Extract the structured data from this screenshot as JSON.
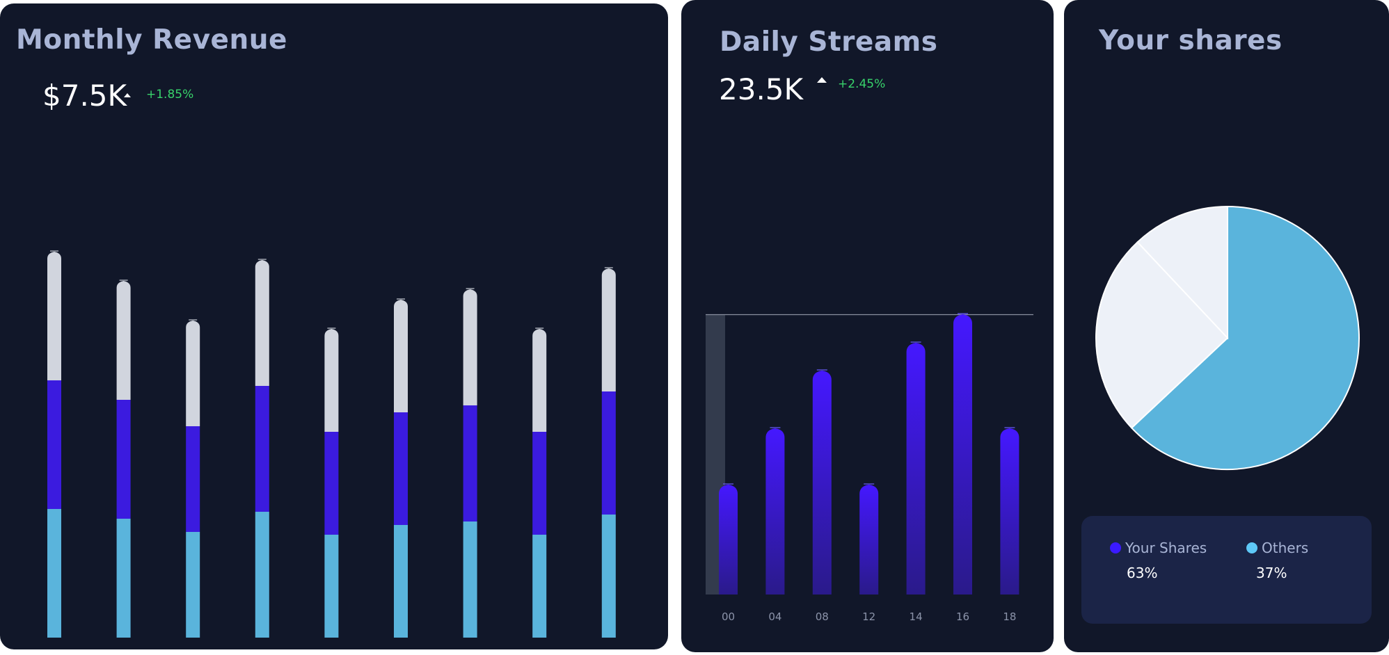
{
  "revenue": {
    "title": "Monthly Revenue",
    "value": "$7.5K",
    "delta": "+1.85%"
  },
  "streams": {
    "title": "Daily Streams",
    "value": "23.5K",
    "delta": "+2.45%"
  },
  "shares": {
    "title": "Your shares",
    "legend": [
      {
        "label": "Your Shares",
        "percent": "63%",
        "color": "#3b1aff"
      },
      {
        "label": "Others",
        "percent": "37%",
        "color": "#5ec8f7"
      }
    ]
  },
  "colors": {
    "card_bg": "#111729",
    "title": "#a9b5d6",
    "delta_green": "#38d36b",
    "seg_bottom": "#5ab4dc",
    "seg_middle": "#3b1bdf",
    "seg_top": "#d1d5de",
    "stream_bar": "#4116f5",
    "pie_main": "#5ab4dc",
    "pie_light": "#edf1f8"
  },
  "chart_data": [
    {
      "type": "bar",
      "stacked": true,
      "title": "Monthly Revenue",
      "categories": [
        "",
        "",
        "",
        "",
        "",
        "",
        "",
        "",
        ""
      ],
      "series": [
        {
          "values": [
            185,
            171,
            152,
            181,
            148,
            162,
            167,
            148,
            177
          ]
        },
        {
          "values": [
            185,
            171,
            152,
            181,
            148,
            162,
            167,
            148,
            177
          ]
        },
        {
          "values": [
            185,
            171,
            152,
            181,
            148,
            162,
            167,
            148,
            177
          ]
        }
      ]
    },
    {
      "type": "bar",
      "title": "Daily Streams",
      "categories": [
        "00",
        "04",
        "08",
        "12",
        "14",
        "16",
        "18"
      ],
      "values": [
        158,
        239,
        322,
        158,
        362,
        403,
        239
      ],
      "ylim": [
        0,
        403
      ]
    },
    {
      "type": "pie",
      "title": "Your shares",
      "slices": [
        {
          "label": "Your Shares",
          "value": 63
        },
        {
          "label": "",
          "value": 25
        },
        {
          "label": "",
          "value": 12
        }
      ]
    }
  ]
}
